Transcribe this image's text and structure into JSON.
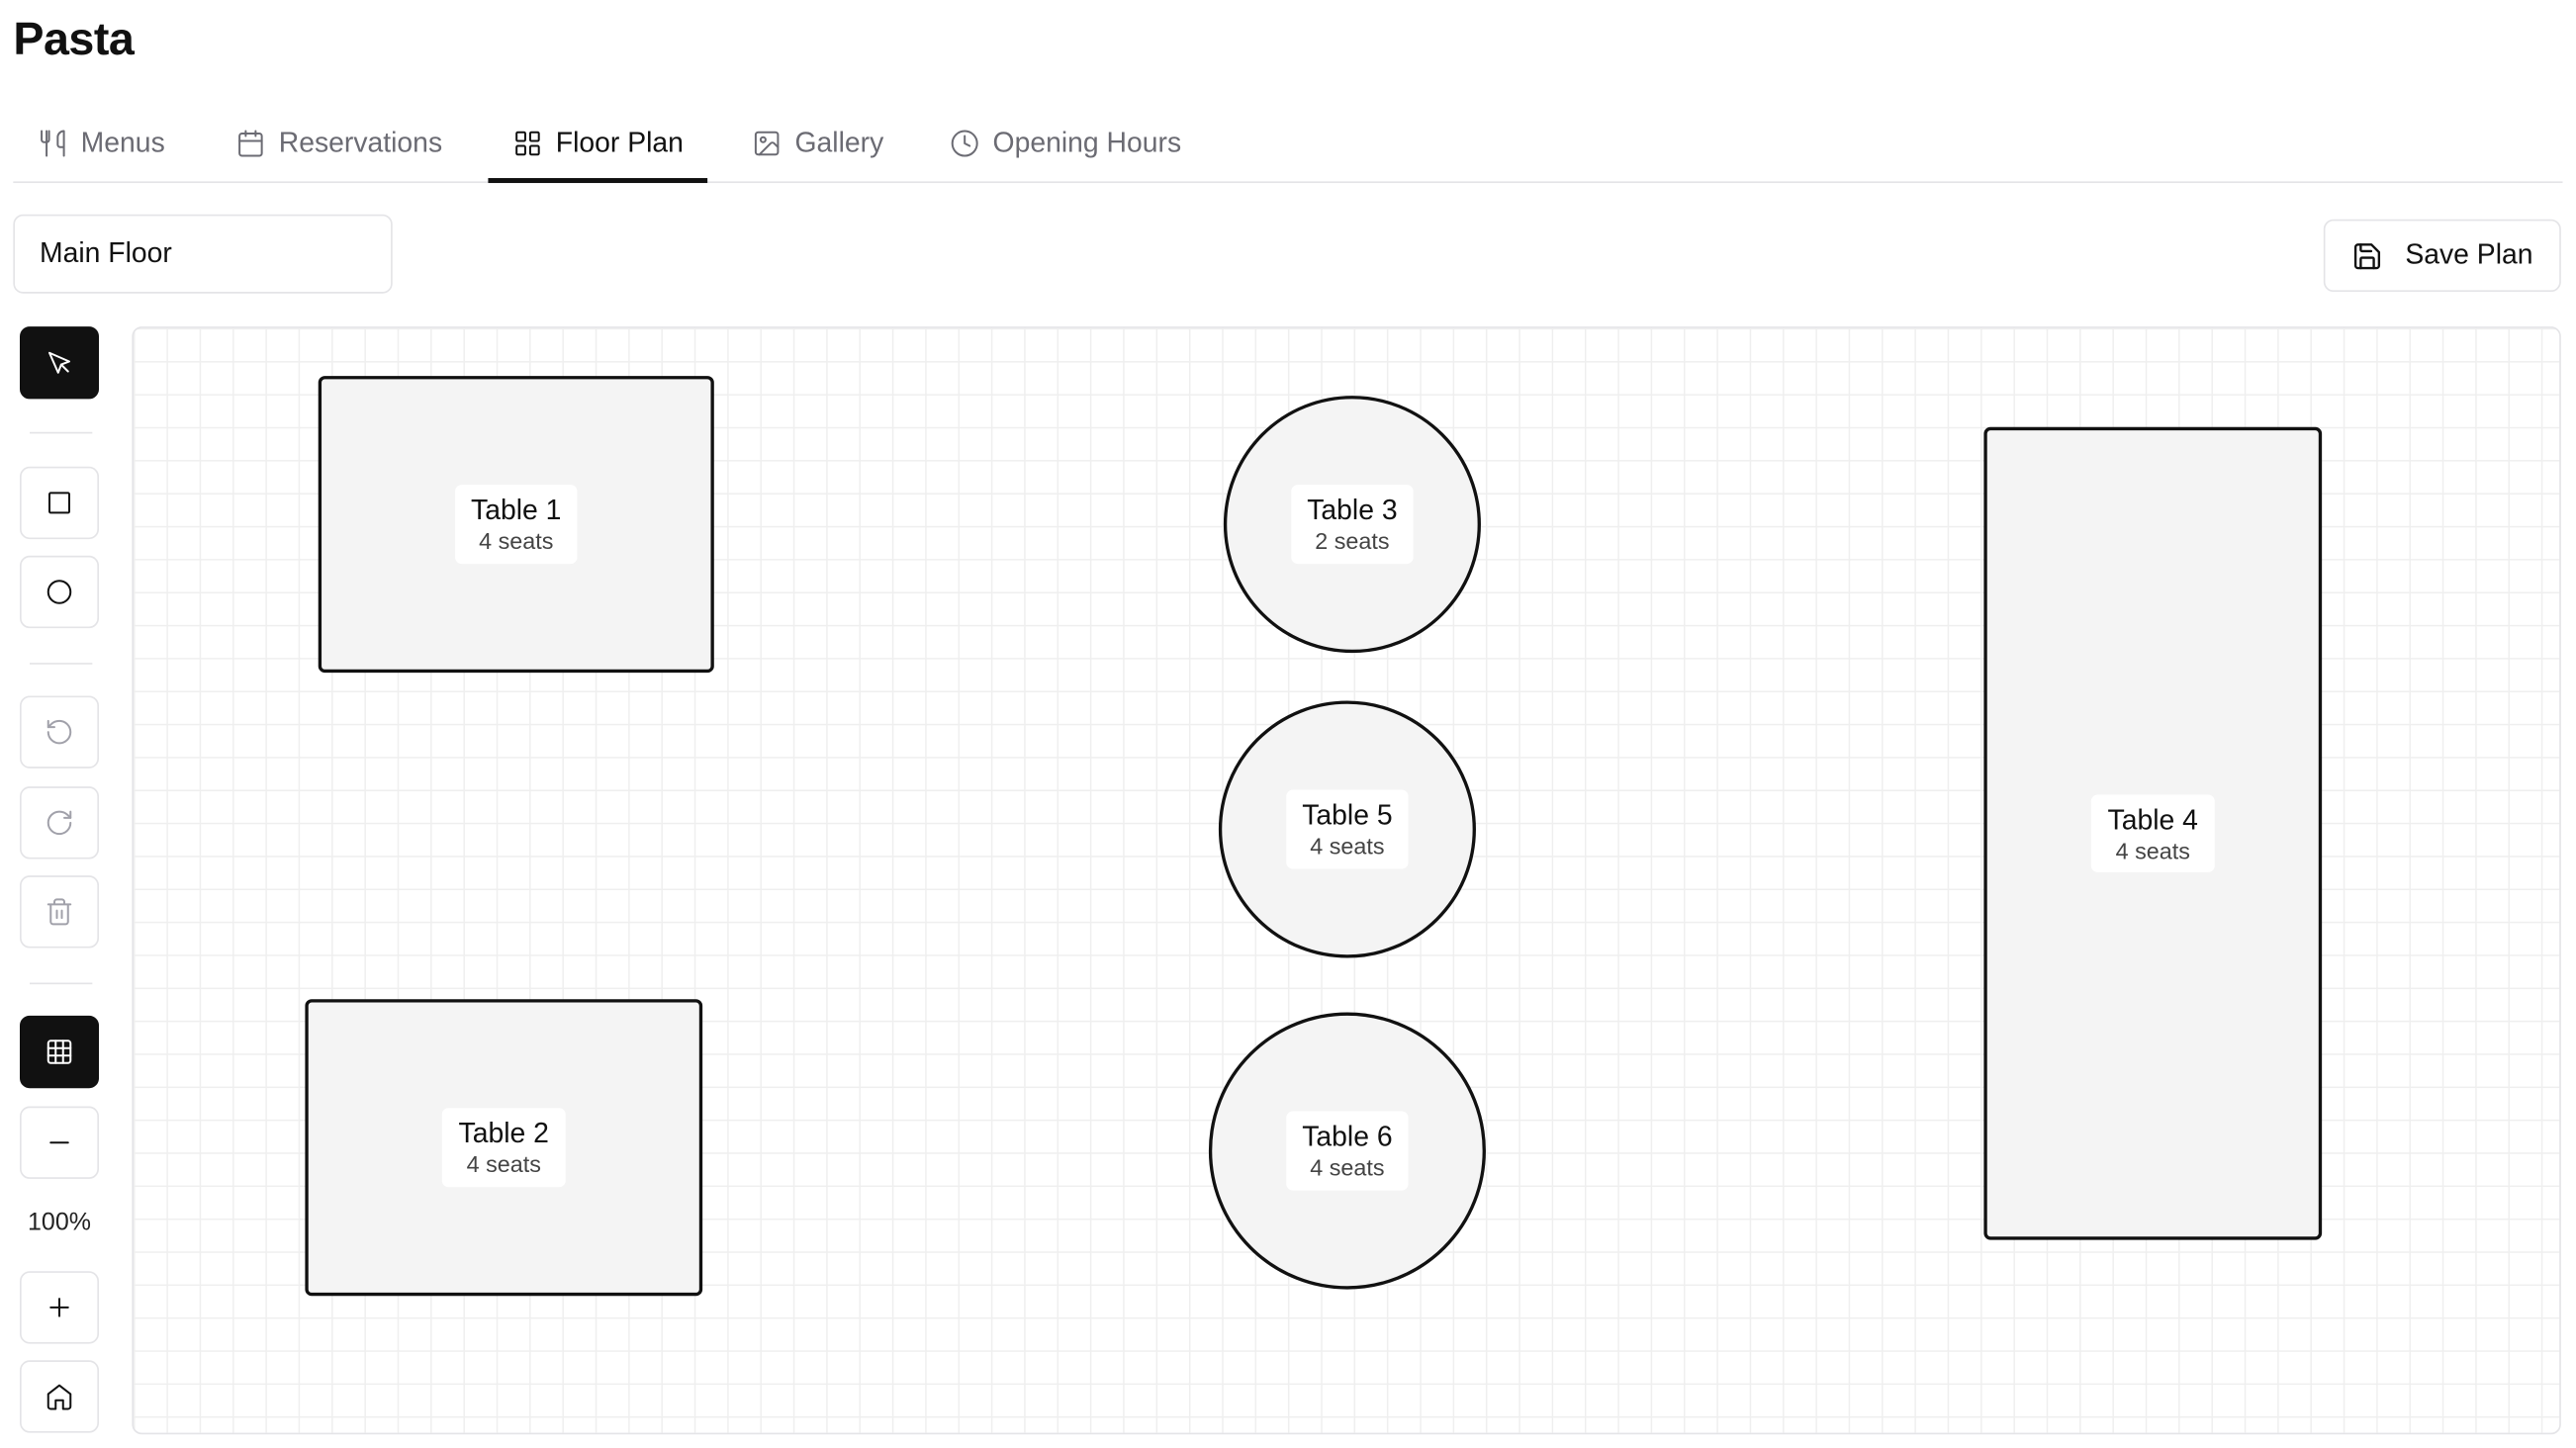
{
  "app": {
    "title": "Pasta"
  },
  "tabs": [
    {
      "label": "Menus",
      "icon": "utensils-icon"
    },
    {
      "label": "Reservations",
      "icon": "calendar-icon"
    },
    {
      "label": "Floor Plan",
      "icon": "layout-grid-icon",
      "active": true
    },
    {
      "label": "Gallery",
      "icon": "image-icon"
    },
    {
      "label": "Opening Hours",
      "icon": "clock-icon"
    }
  ],
  "floor": {
    "name": "Main Floor"
  },
  "toolbar": {
    "save_label": "Save Plan",
    "zoom": "100%"
  },
  "tables": [
    {
      "name": "Table 1",
      "seats": "4 seats",
      "shape": "rect"
    },
    {
      "name": "Table 2",
      "seats": "4 seats",
      "shape": "rect"
    },
    {
      "name": "Table 3",
      "seats": "2 seats",
      "shape": "round"
    },
    {
      "name": "Table 4",
      "seats": "4 seats",
      "shape": "rect"
    },
    {
      "name": "Table 5",
      "seats": "4 seats",
      "shape": "round"
    },
    {
      "name": "Table 6",
      "seats": "4 seats",
      "shape": "round"
    }
  ]
}
